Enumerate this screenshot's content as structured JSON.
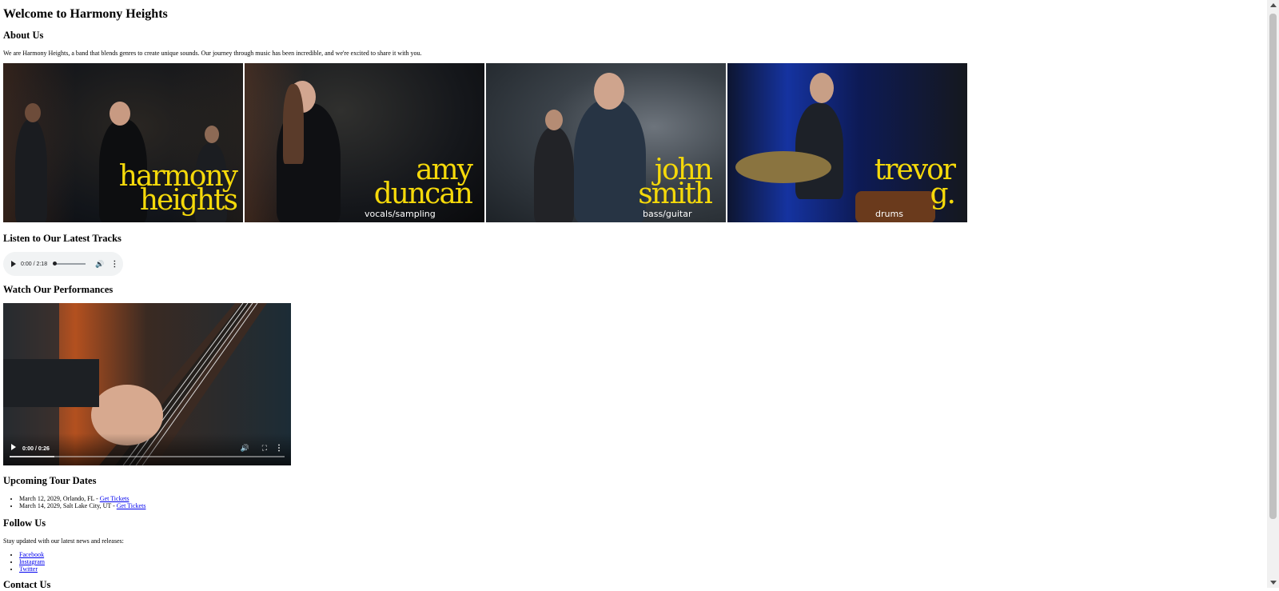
{
  "page": {
    "title": "Welcome to Harmony Heights"
  },
  "about": {
    "heading": "About Us",
    "text": "We are Harmony Heights, a band that blends genres to create unique sounds. Our journey through music has been incredible, and we're excited to share it with you."
  },
  "gallery": [
    {
      "name": "harmony heights",
      "role": "",
      "icon": "band-photo"
    },
    {
      "name": "amy duncan",
      "role": "vocals/sampling",
      "icon": "singer-photo"
    },
    {
      "name": "john smith",
      "role": "bass/guitar",
      "icon": "bassist-photo"
    },
    {
      "name": "trevor g.",
      "role": "drums",
      "icon": "drummer-photo"
    }
  ],
  "tracks": {
    "heading": "Listen to Our Latest Tracks",
    "audio_time": "0:00 / 2:18"
  },
  "performances": {
    "heading": "Watch Our Performances",
    "video_time": "0:00 / 0:26"
  },
  "tour": {
    "heading": "Upcoming Tour Dates",
    "dates": [
      {
        "text": "March 12, 2029, Orlando, FL - ",
        "link": "Get Tickets"
      },
      {
        "text": "March 14, 2029, Salt Lake City, UT - ",
        "link": "Get Tickets"
      }
    ]
  },
  "follow": {
    "heading": "Follow Us",
    "text": "Stay updated with our latest news and releases:",
    "links": [
      "Facebook",
      "Instagram",
      "Twitter"
    ]
  },
  "contact": {
    "heading": "Contact Us"
  },
  "colors": {
    "accent": "#f5d90a",
    "link": "#0000ee"
  }
}
